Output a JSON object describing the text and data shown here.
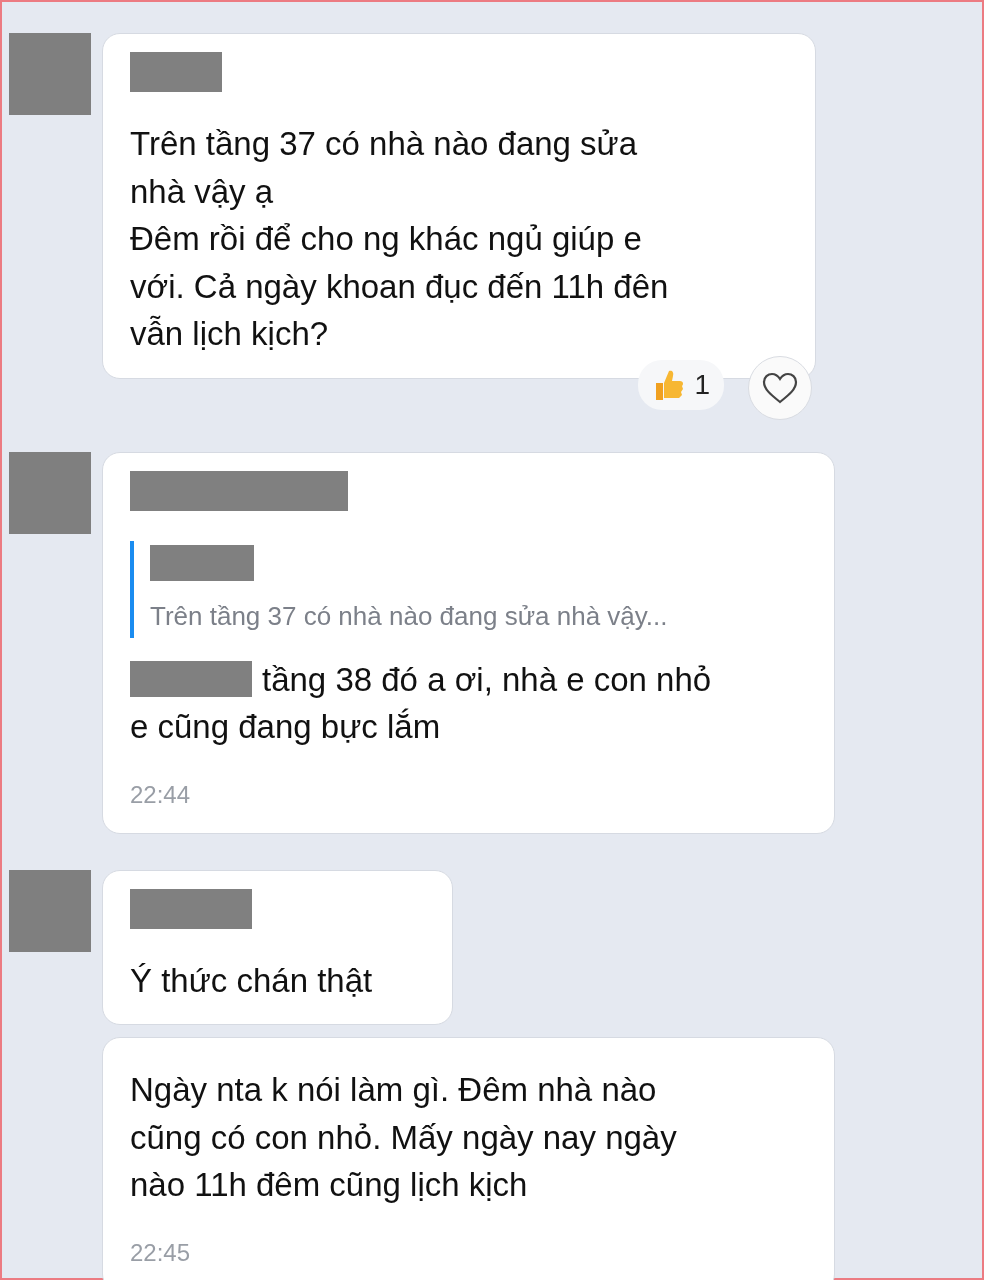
{
  "messages": [
    {
      "avatar": true,
      "sender_redacted": true,
      "text": "Trên tầng 37 có nhà nào đang sửa\nnhà vậy ạ\nĐêm rồi để cho ng khác ngủ giúp e\nvới. Cả ngày khoan đục đến 11h đên\nvẫn lịch kịch?",
      "reaction": {
        "count": "1"
      },
      "liked": false
    },
    {
      "avatar": true,
      "sender_redacted": true,
      "quote": {
        "sender_redacted": true,
        "text": "Trên tầng 37 có nhà nào đang sửa nhà vậy..."
      },
      "mention_redacted": true,
      "text": "tầng 38 đó a ơi, nhà e con nhỏ\ne cũng đang bực lắm",
      "time": "22:44"
    },
    {
      "avatar": true,
      "sender_redacted": true,
      "text": "Ý thức chán thật"
    },
    {
      "avatar": false,
      "sender_redacted": false,
      "text": "Ngày nta k nói làm gì. Đêm nhà nào\ncũng có con nhỏ. Mấy ngày nay ngày\nnào 11h đêm cũng lịch kịch",
      "time": "22:45"
    }
  ]
}
